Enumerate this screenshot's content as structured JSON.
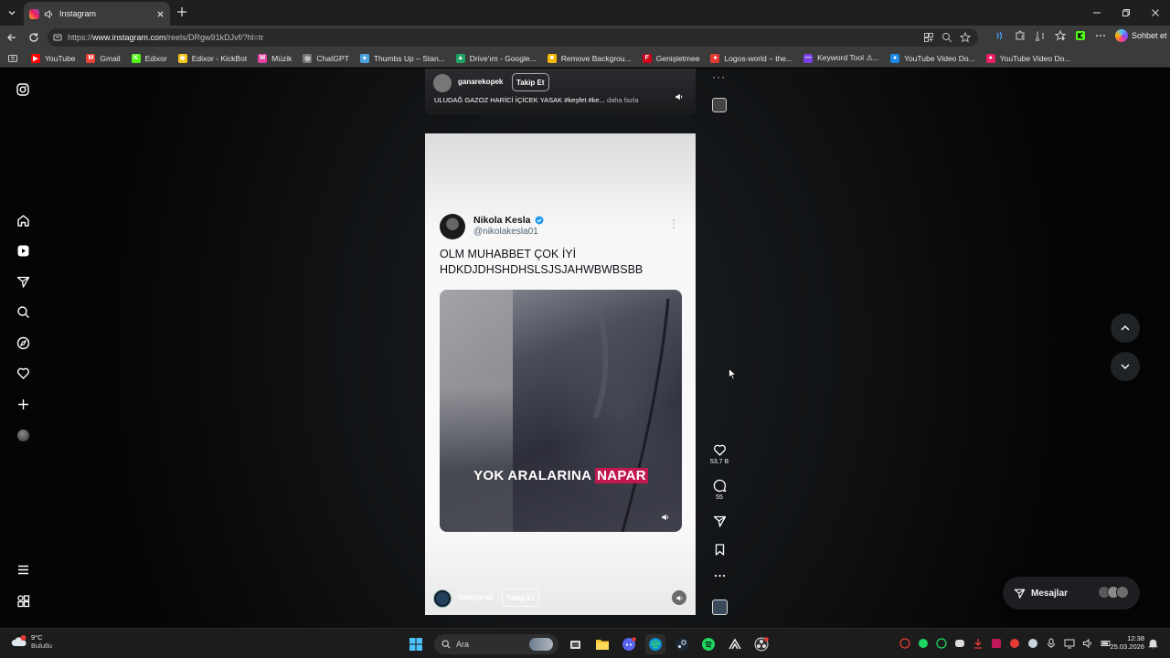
{
  "browser": {
    "tab": {
      "title": "Instagram"
    },
    "url": {
      "scheme": "https://",
      "host": "www.instagram.com",
      "path": "/reels/DRgw91kDJvf/?hl=tr"
    },
    "copilot_label": "Sohbet et",
    "bookmarks": [
      {
        "label": "YouTube",
        "color": "#ff0000",
        "glyph": "▶"
      },
      {
        "label": "Gmail",
        "color": "#ea4335",
        "glyph": "M"
      },
      {
        "label": "Edixor",
        "color": "#53fc18",
        "glyph": "K"
      },
      {
        "label": "Edixor - KickBot",
        "color": "#f5c518",
        "glyph": "✱"
      },
      {
        "label": "Müzik",
        "color": "#e040a0",
        "glyph": "M"
      },
      {
        "label": "ChatGPT",
        "color": "#777777",
        "glyph": "◎"
      },
      {
        "label": "Thumbs Up – Stan...",
        "color": "#4aa3df",
        "glyph": "✦"
      },
      {
        "label": "Drive'ım - Google...",
        "color": "#1ea362",
        "glyph": "▲"
      },
      {
        "label": "Remove Backgrou...",
        "color": "#f2b705",
        "glyph": "■"
      },
      {
        "label": "Genişletmee",
        "color": "#d0021b",
        "glyph": "F"
      },
      {
        "label": "Logos-world – the...",
        "color": "#e53935",
        "glyph": "●"
      },
      {
        "label": "Keyword Tool ⚠...",
        "color": "#7b3fe4",
        "glyph": "—"
      },
      {
        "label": "YouTube Video Do...",
        "color": "#1e88e5",
        "glyph": "●"
      },
      {
        "label": "YouTube Video Do...",
        "color": "#e91e63",
        "glyph": "●"
      }
    ]
  },
  "prev_reel": {
    "username": "ganarekopek",
    "follow_label": "Takip Et",
    "caption": "ULUDAĞ GAZOZ HARİCİ İÇİCEK YASAK #keşfet #ke...",
    "more_label": "daha fazla"
  },
  "reel": {
    "tweet": {
      "name": "Nikola Kesla",
      "handle": "@nikolakesla01",
      "text": "OLM MUHABBET ÇOK İYİ HDKDJDHSHDHSLSJSJAHWBWBSBB"
    },
    "video_caption": {
      "plain": "YOK ARALARINA",
      "highlight": "NAPAR"
    },
    "footer": {
      "username": "balicigrup",
      "follow_label": "Takip Et"
    }
  },
  "actions": {
    "likes": "53,7 B",
    "comments": "55"
  },
  "messages": {
    "label": "Mesajlar"
  },
  "taskbar": {
    "weather_temp": "9°C",
    "weather_desc": "Bulutlu",
    "search_label": "Ara",
    "time": "12:38",
    "date": "25.03.2026"
  },
  "colors": {
    "caption_highlight": "#c2184f",
    "verified": "#1d9bf0"
  }
}
